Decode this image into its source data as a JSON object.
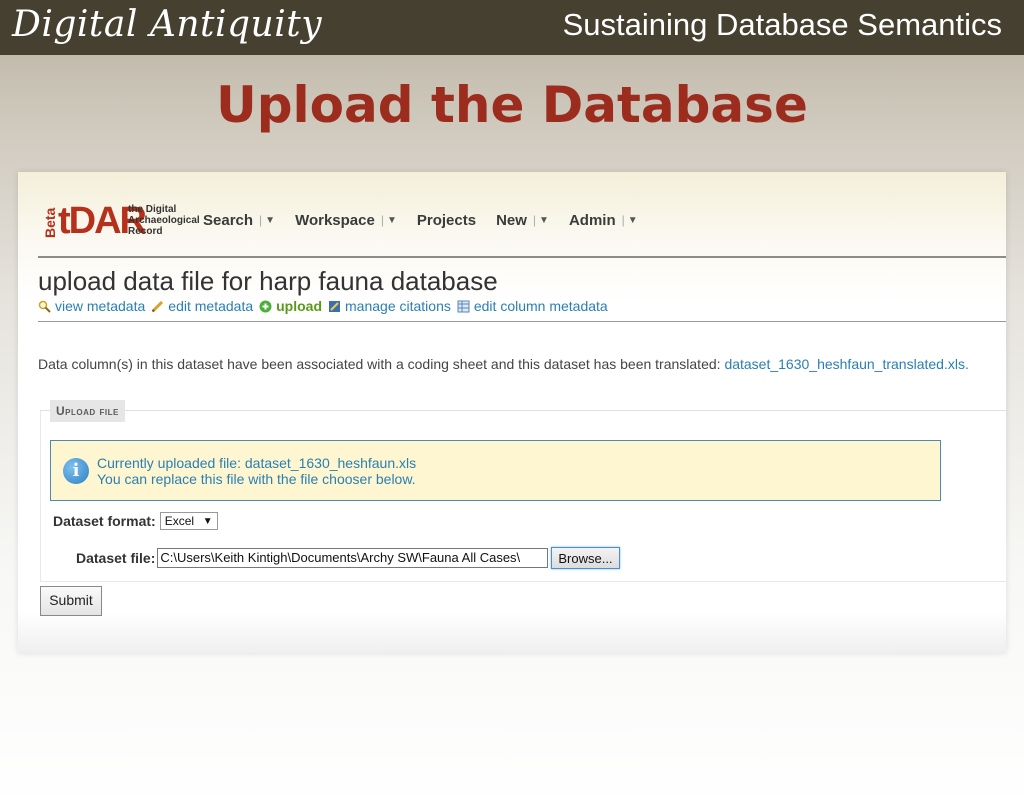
{
  "banner": {
    "brand": "Digital Antiquity",
    "subtitle": "Sustaining Database Semantics"
  },
  "slide_title": "Upload the Database",
  "app": {
    "logo": {
      "beta": "Beta",
      "name": "tDAR",
      "tagline_1": "the Digital",
      "tagline_2": "Archaeological",
      "tagline_3": "Record"
    },
    "nav": [
      {
        "label": "Search",
        "dropdown": true
      },
      {
        "label": "Workspace",
        "dropdown": true
      },
      {
        "label": "Projects",
        "dropdown": false
      },
      {
        "label": "New",
        "dropdown": true
      },
      {
        "label": "Admin",
        "dropdown": true
      }
    ],
    "page_heading": "upload data file for harp fauna database",
    "actions": {
      "view_metadata": "view metadata",
      "edit_metadata": "edit metadata",
      "upload": "upload",
      "manage_citations": "manage citations",
      "edit_column_metadata": "edit column metadata"
    },
    "info_text": "Data column(s) in this dataset have been associated with a coding sheet and this dataset has been translated: ",
    "info_link": "dataset_1630_heshfaun_translated.xls.",
    "section_legend": "Upload file",
    "alert": {
      "line1_prefix": "Currently uploaded file: ",
      "line1_link": "dataset_1630_heshfaun.xls",
      "line2": "You can replace this file with the file chooser below."
    },
    "form": {
      "format_label": "Dataset format:",
      "format_value": "Excel",
      "file_label": "Dataset file:",
      "file_value": "C:\\Users\\Keith Kintigh\\Documents\\Archy SW\\Fauna All Cases\\",
      "browse_label": "Browse...",
      "submit_label": "Submit"
    }
  }
}
